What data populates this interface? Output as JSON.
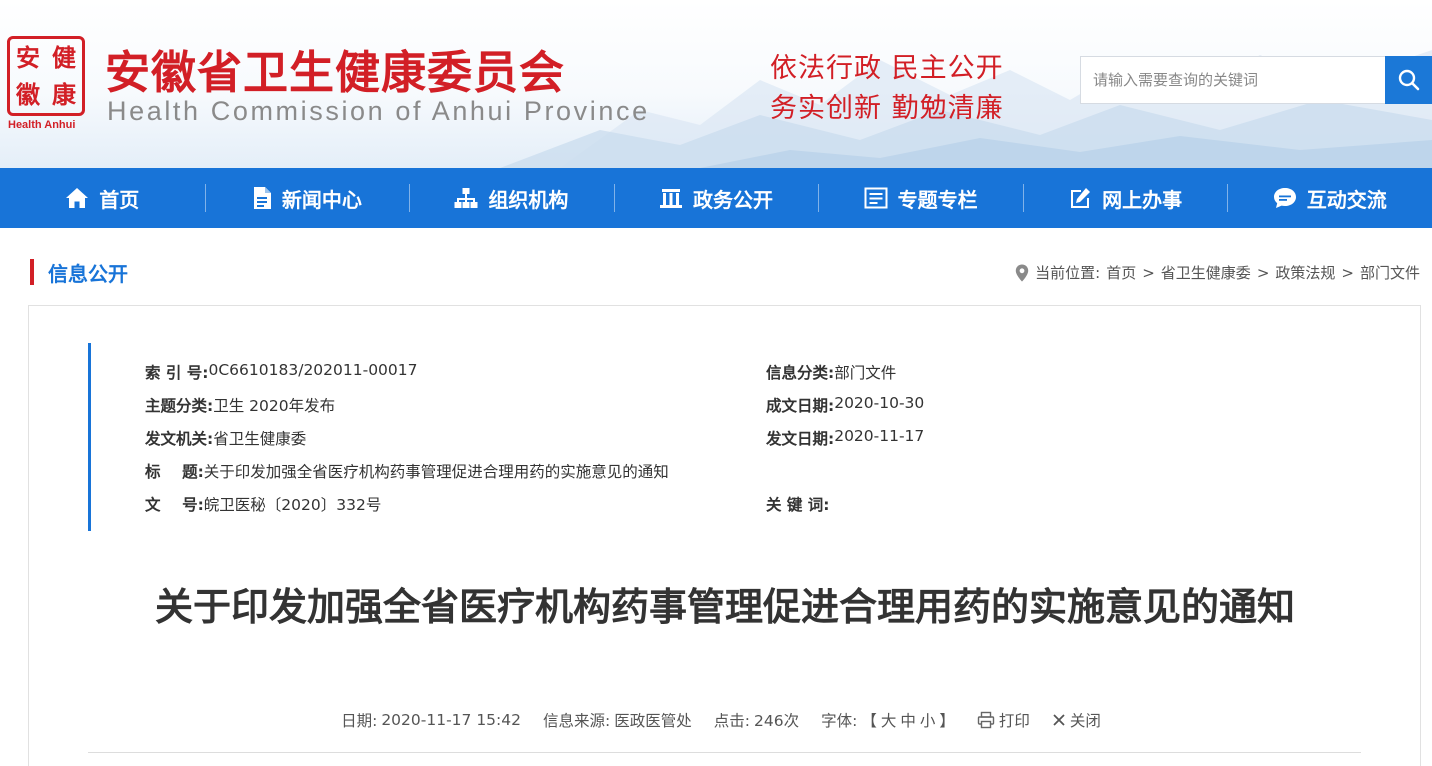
{
  "header": {
    "seal_chars": [
      "健",
      "安",
      "徽",
      "康"
    ],
    "seal_label": "Health Anhui",
    "title": "安徽省卫生健康委员会",
    "subtitle": "Health Commission of Anhui Province",
    "slogan_line1": "依法行政  民主公开",
    "slogan_line2": "务实创新  勤勉清廉",
    "search_placeholder": "请输入需要查询的关键词",
    "search_icon": "search-icon"
  },
  "nav": {
    "items": [
      {
        "label": "首页",
        "icon": "home-icon"
      },
      {
        "label": "新闻中心",
        "icon": "document-icon"
      },
      {
        "label": "组织机构",
        "icon": "org-chart-icon"
      },
      {
        "label": "政务公开",
        "icon": "building-icon"
      },
      {
        "label": "专题专栏",
        "icon": "list-box-icon"
      },
      {
        "label": "网上办事",
        "icon": "edit-icon"
      },
      {
        "label": "互动交流",
        "icon": "chat-icon"
      }
    ]
  },
  "section": {
    "title": "信息公开"
  },
  "breadcrumb": {
    "prefix": "当前位置:",
    "items": [
      "首页",
      "省卫生健康委",
      "政策法规",
      "部门文件"
    ],
    "separator": ">"
  },
  "meta": {
    "index_no": {
      "label": "索 引 号:",
      "value": "0C6610183/202011-00017"
    },
    "info_category": {
      "label": "信息分类:",
      "value": "部门文件"
    },
    "topic": {
      "label": "主题分类:",
      "value": "卫生 2020年发布"
    },
    "created_date": {
      "label": "成文日期:",
      "value": "2020-10-30"
    },
    "issuer": {
      "label": "发文机关:",
      "value": "省卫生健康委"
    },
    "issued_date": {
      "label": "发文日期:",
      "value": "2020-11-17"
    },
    "title": {
      "label": "标    题:",
      "value": "关于印发加强全省医疗机构药事管理促进合理用药的实施意见的通知"
    },
    "doc_no": {
      "label": "文    号:",
      "value": "皖卫医秘〔2020〕332号"
    },
    "keywords": {
      "label": "关 键 词:",
      "value": ""
    }
  },
  "article": {
    "title": "关于印发加强全省医疗机构药事管理促进合理用药的实施意见的通知",
    "date_label": "日期:",
    "date": "2020-11-17 15:42",
    "source_label": "信息来源:",
    "source": "医政医管处",
    "clicks_label": "点击:",
    "clicks": "246次",
    "font_label": "字体:",
    "font_open": "【",
    "font_large": "大",
    "font_medium": "中",
    "font_small": "小",
    "font_close": "】",
    "print_label": "打印",
    "close_label": "关闭"
  },
  "colors": {
    "brand_red": "#d21f26",
    "nav_blue": "#1874d8"
  }
}
